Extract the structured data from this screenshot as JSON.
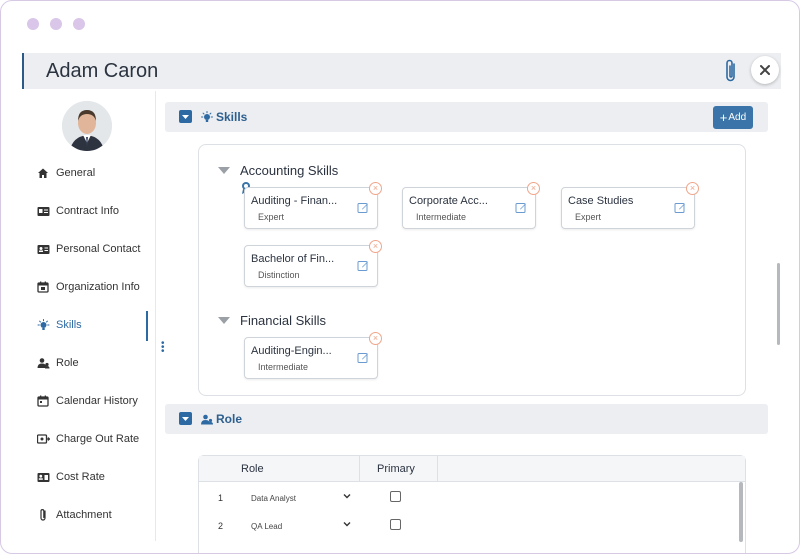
{
  "header": {
    "title": "Adam Caron"
  },
  "sidebar": {
    "items": [
      {
        "label": "General",
        "icon": "home-icon"
      },
      {
        "label": "Contract Info",
        "icon": "id-card-icon"
      },
      {
        "label": "Personal Contact",
        "icon": "contact-card-icon"
      },
      {
        "label": "Organization Info",
        "icon": "calendar-org-icon"
      },
      {
        "label": "Skills",
        "icon": "lightbulb-icon",
        "active": true
      },
      {
        "label": "Role",
        "icon": "people-icon"
      },
      {
        "label": "Calendar History",
        "icon": "calendar-icon"
      },
      {
        "label": "Charge Out Rate",
        "icon": "money-out-icon"
      },
      {
        "label": "Cost Rate",
        "icon": "cost-card-icon"
      },
      {
        "label": "Attachment",
        "icon": "paperclip-icon"
      }
    ]
  },
  "skills_section": {
    "title": "Skills",
    "add_label": "Add",
    "groups": [
      {
        "title": "Accounting Skills",
        "skills": [
          {
            "name": "Auditing - Finan...",
            "level": "Expert"
          },
          {
            "name": "Corporate Acc...",
            "level": "Intermediate"
          },
          {
            "name": "Case Studies",
            "level": "Expert"
          },
          {
            "name": "Bachelor of Fin...",
            "level": "Distinction"
          }
        ]
      },
      {
        "title": "Financial Skills",
        "skills": [
          {
            "name": "Auditing-Engin...",
            "level": "Intermediate"
          }
        ]
      }
    ]
  },
  "role_section": {
    "title": "Role",
    "columns": [
      "Role",
      "Primary"
    ],
    "rows": [
      {
        "num": "1",
        "role": "Data Analyst",
        "primary": false
      },
      {
        "num": "2",
        "role": "QA Lead",
        "primary": false
      }
    ]
  },
  "colors": {
    "accent": "#2d6aa3",
    "remove": "#f0a58a",
    "header_bg": "#eceef1"
  }
}
